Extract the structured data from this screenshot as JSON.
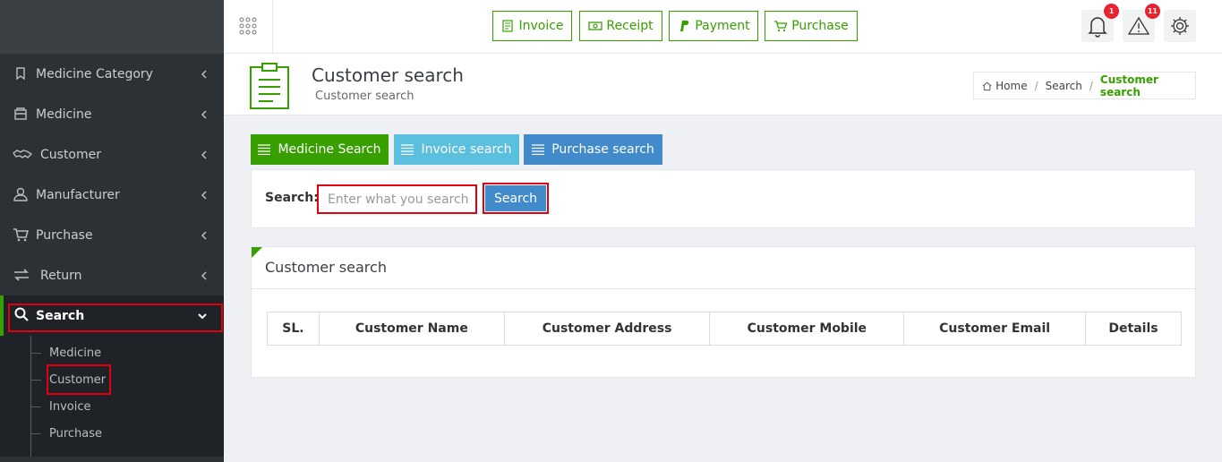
{
  "sidebar": {
    "items": [
      {
        "label": "Medicine Category",
        "icon": "bookmark-icon"
      },
      {
        "label": "Medicine",
        "icon": "box-icon"
      },
      {
        "label": "Customer",
        "icon": "handshake-icon"
      },
      {
        "label": "Manufacturer",
        "icon": "user-icon"
      },
      {
        "label": "Purchase",
        "icon": "cart-icon"
      },
      {
        "label": "Return",
        "icon": "exchange-icon"
      },
      {
        "label": "Search",
        "icon": "search-icon"
      }
    ],
    "submenu": [
      {
        "label": "Medicine"
      },
      {
        "label": "Customer"
      },
      {
        "label": "Invoice"
      },
      {
        "label": "Purchase"
      }
    ]
  },
  "topbar": {
    "quick_buttons": [
      {
        "label": "Invoice",
        "icon": "invoice-icon"
      },
      {
        "label": "Receipt",
        "icon": "money-icon"
      },
      {
        "label": "Payment",
        "icon": "paypal-icon"
      },
      {
        "label": "Purchase",
        "icon": "cart-icon"
      }
    ],
    "notifications_count": "1",
    "alerts_count": "11"
  },
  "header": {
    "title": "Customer search",
    "subtitle": "Customer search",
    "breadcrumb": {
      "home": "Home",
      "section": "Search",
      "current": "Customer search"
    }
  },
  "tabs": [
    {
      "label": "Medicine Search",
      "color": "#37a000"
    },
    {
      "label": "Invoice search",
      "color": "#5bc0de"
    },
    {
      "label": "Purchase search",
      "color": "#428bca"
    }
  ],
  "search": {
    "label": "Search:",
    "placeholder": "Enter what you search",
    "value": "",
    "button_label": "Search"
  },
  "results": {
    "title": "Customer search",
    "columns": [
      "SL.",
      "Customer Name",
      "Customer Address",
      "Customer Mobile",
      "Customer Email",
      "Details"
    ]
  },
  "colors": {
    "accent": "#37a000",
    "sidebar_bg": "#2c3136",
    "highlight": "#e00010"
  }
}
